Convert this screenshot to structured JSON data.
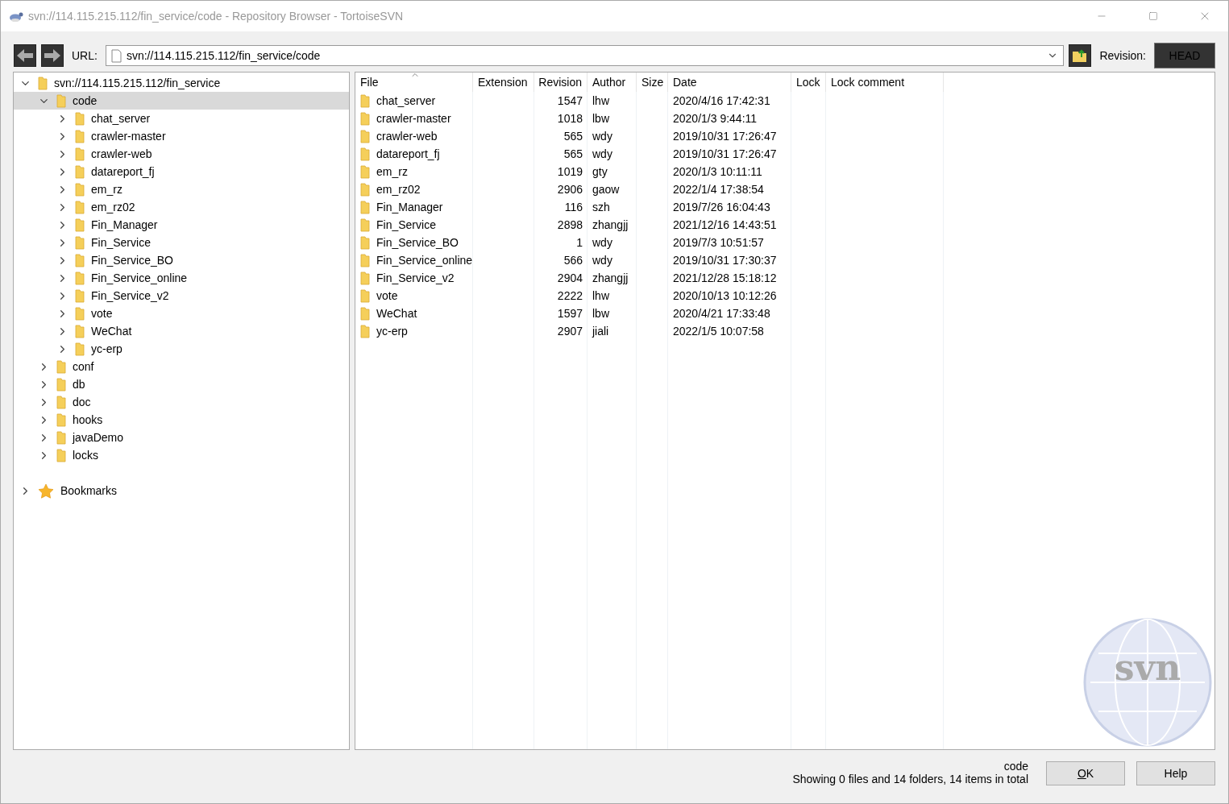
{
  "window": {
    "title": "svn://114.115.215.112/fin_service/code - Repository Browser - TortoiseSVN"
  },
  "toolbar": {
    "url_label": "URL:",
    "url": "svn://114.115.215.112/fin_service/code",
    "revision_label": "Revision:",
    "revision": "HEAD"
  },
  "tree": [
    {
      "label": "svn://114.115.215.112/fin_service",
      "expanded": true,
      "selected": false,
      "kind": "folder",
      "children": [
        {
          "label": "code",
          "expanded": true,
          "selected": true,
          "kind": "folder",
          "children": [
            {
              "label": "chat_server",
              "expanded": false,
              "selected": false,
              "kind": "folder"
            },
            {
              "label": "crawler-master",
              "expanded": false,
              "selected": false,
              "kind": "folder"
            },
            {
              "label": "crawler-web",
              "expanded": false,
              "selected": false,
              "kind": "folder"
            },
            {
              "label": "datareport_fj",
              "expanded": false,
              "selected": false,
              "kind": "folder"
            },
            {
              "label": "em_rz",
              "expanded": false,
              "selected": false,
              "kind": "folder"
            },
            {
              "label": "em_rz02",
              "expanded": false,
              "selected": false,
              "kind": "folder"
            },
            {
              "label": "Fin_Manager",
              "expanded": false,
              "selected": false,
              "kind": "folder"
            },
            {
              "label": "Fin_Service",
              "expanded": false,
              "selected": false,
              "kind": "folder"
            },
            {
              "label": "Fin_Service_BO",
              "expanded": false,
              "selected": false,
              "kind": "folder"
            },
            {
              "label": "Fin_Service_online",
              "expanded": false,
              "selected": false,
              "kind": "folder"
            },
            {
              "label": "Fin_Service_v2",
              "expanded": false,
              "selected": false,
              "kind": "folder"
            },
            {
              "label": "vote",
              "expanded": false,
              "selected": false,
              "kind": "folder"
            },
            {
              "label": "WeChat",
              "expanded": false,
              "selected": false,
              "kind": "folder"
            },
            {
              "label": "yc-erp",
              "expanded": false,
              "selected": false,
              "kind": "folder"
            }
          ]
        },
        {
          "label": "conf",
          "expanded": false,
          "selected": false,
          "kind": "folder"
        },
        {
          "label": "db",
          "expanded": false,
          "selected": false,
          "kind": "folder"
        },
        {
          "label": "doc",
          "expanded": false,
          "selected": false,
          "kind": "folder"
        },
        {
          "label": "hooks",
          "expanded": false,
          "selected": false,
          "kind": "folder"
        },
        {
          "label": "javaDemo",
          "expanded": false,
          "selected": false,
          "kind": "folder"
        },
        {
          "label": "locks",
          "expanded": false,
          "selected": false,
          "kind": "folder"
        }
      ]
    },
    {
      "label": "Bookmarks",
      "expanded": false,
      "selected": false,
      "kind": "bookmarks"
    }
  ],
  "table": {
    "columns": [
      "File",
      "Extension",
      "Revision",
      "Author",
      "Size",
      "Date",
      "Lock",
      "Lock comment"
    ],
    "rows": [
      [
        "chat_server",
        "",
        "1547",
        "lhw",
        "",
        "2020/4/16 17:42:31",
        "",
        ""
      ],
      [
        "crawler-master",
        "",
        "1018",
        "lbw",
        "",
        "2020/1/3 9:44:11",
        "",
        ""
      ],
      [
        "crawler-web",
        "",
        "565",
        "wdy",
        "",
        "2019/10/31 17:26:47",
        "",
        ""
      ],
      [
        "datareport_fj",
        "",
        "565",
        "wdy",
        "",
        "2019/10/31 17:26:47",
        "",
        ""
      ],
      [
        "em_rz",
        "",
        "1019",
        "gty",
        "",
        "2020/1/3 10:11:11",
        "",
        ""
      ],
      [
        "em_rz02",
        "",
        "2906",
        "gaow",
        "",
        "2022/1/4 17:38:54",
        "",
        ""
      ],
      [
        "Fin_Manager",
        "",
        "116",
        "szh",
        "",
        "2019/7/26 16:04:43",
        "",
        ""
      ],
      [
        "Fin_Service",
        "",
        "2898",
        "zhangjj",
        "",
        "2021/12/16 14:43:51",
        "",
        ""
      ],
      [
        "Fin_Service_BO",
        "",
        "1",
        "wdy",
        "",
        "2019/7/3 10:51:57",
        "",
        ""
      ],
      [
        "Fin_Service_online",
        "",
        "566",
        "wdy",
        "",
        "2019/10/31 17:30:37",
        "",
        ""
      ],
      [
        "Fin_Service_v2",
        "",
        "2904",
        "zhangjj",
        "",
        "2021/12/28 15:18:12",
        "",
        ""
      ],
      [
        "vote",
        "",
        "2222",
        "lhw",
        "",
        "2020/10/13 10:12:26",
        "",
        ""
      ],
      [
        "WeChat",
        "",
        "1597",
        "lbw",
        "",
        "2020/4/21 17:33:48",
        "",
        ""
      ],
      [
        "yc-erp",
        "",
        "2907",
        "jiali",
        "",
        "2022/1/5 10:07:58",
        "",
        ""
      ]
    ]
  },
  "logo_text": "svn",
  "status": {
    "path": "code",
    "summary": "Showing 0 files and 14 folders, 14 items in total"
  },
  "buttons": [
    "OK",
    "Help"
  ]
}
